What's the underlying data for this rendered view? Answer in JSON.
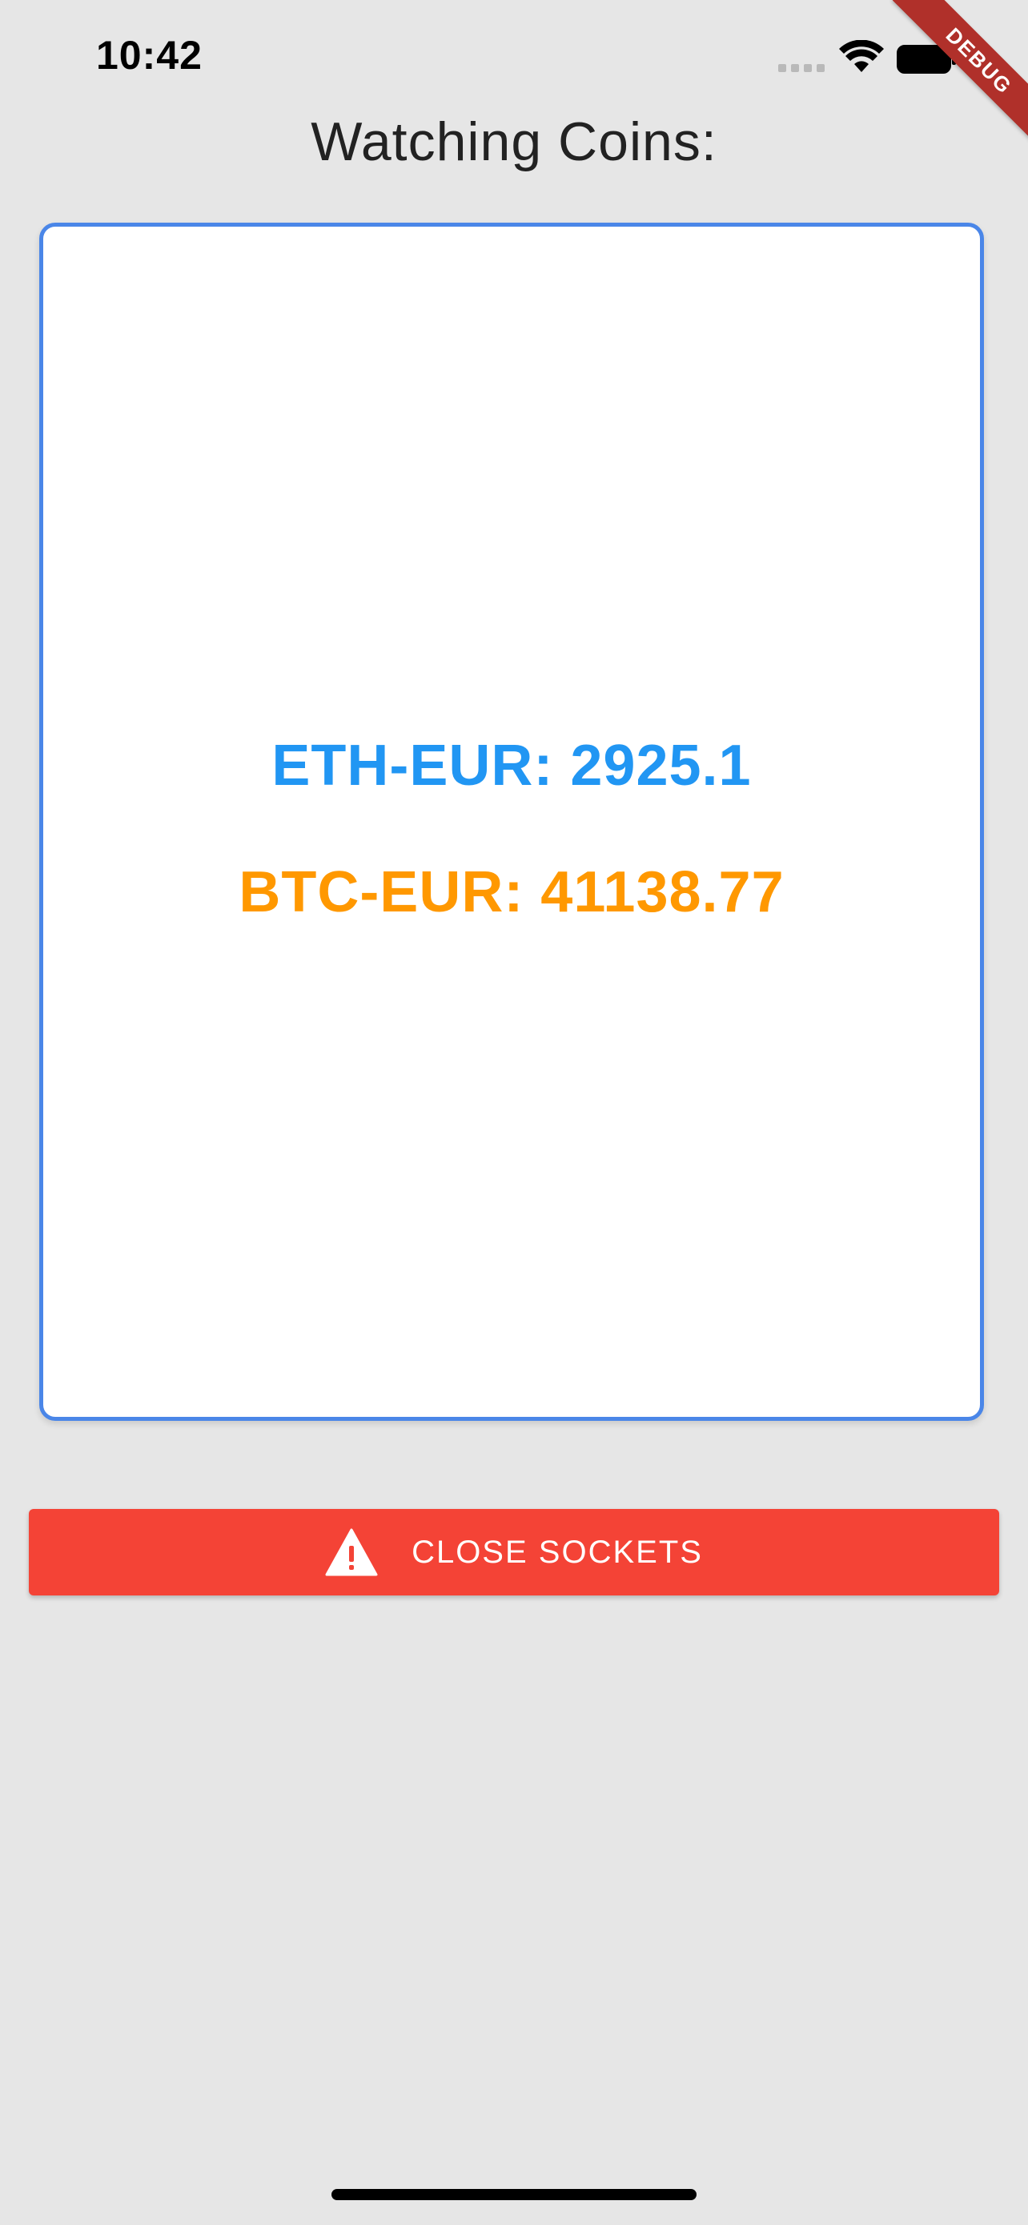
{
  "status_bar": {
    "time": "10:42"
  },
  "debug_banner": {
    "label": "DEBUG",
    "color": "#b0302a"
  },
  "header": {
    "title": "Watching Coins:"
  },
  "coins": [
    {
      "label": "ETH-EUR: 2925.1",
      "color": "#2196f3"
    },
    {
      "label": "BTC-EUR: 41138.77",
      "color": "#ff9800"
    }
  ],
  "card": {
    "border_color": "#4a86e8"
  },
  "close_button": {
    "label": "CLOSE SOCKETS",
    "icon": "warning-icon",
    "color": "#f44336"
  },
  "icons": {
    "signal": "cellular-signal-icon",
    "wifi": "wifi-icon",
    "battery": "battery-icon"
  }
}
